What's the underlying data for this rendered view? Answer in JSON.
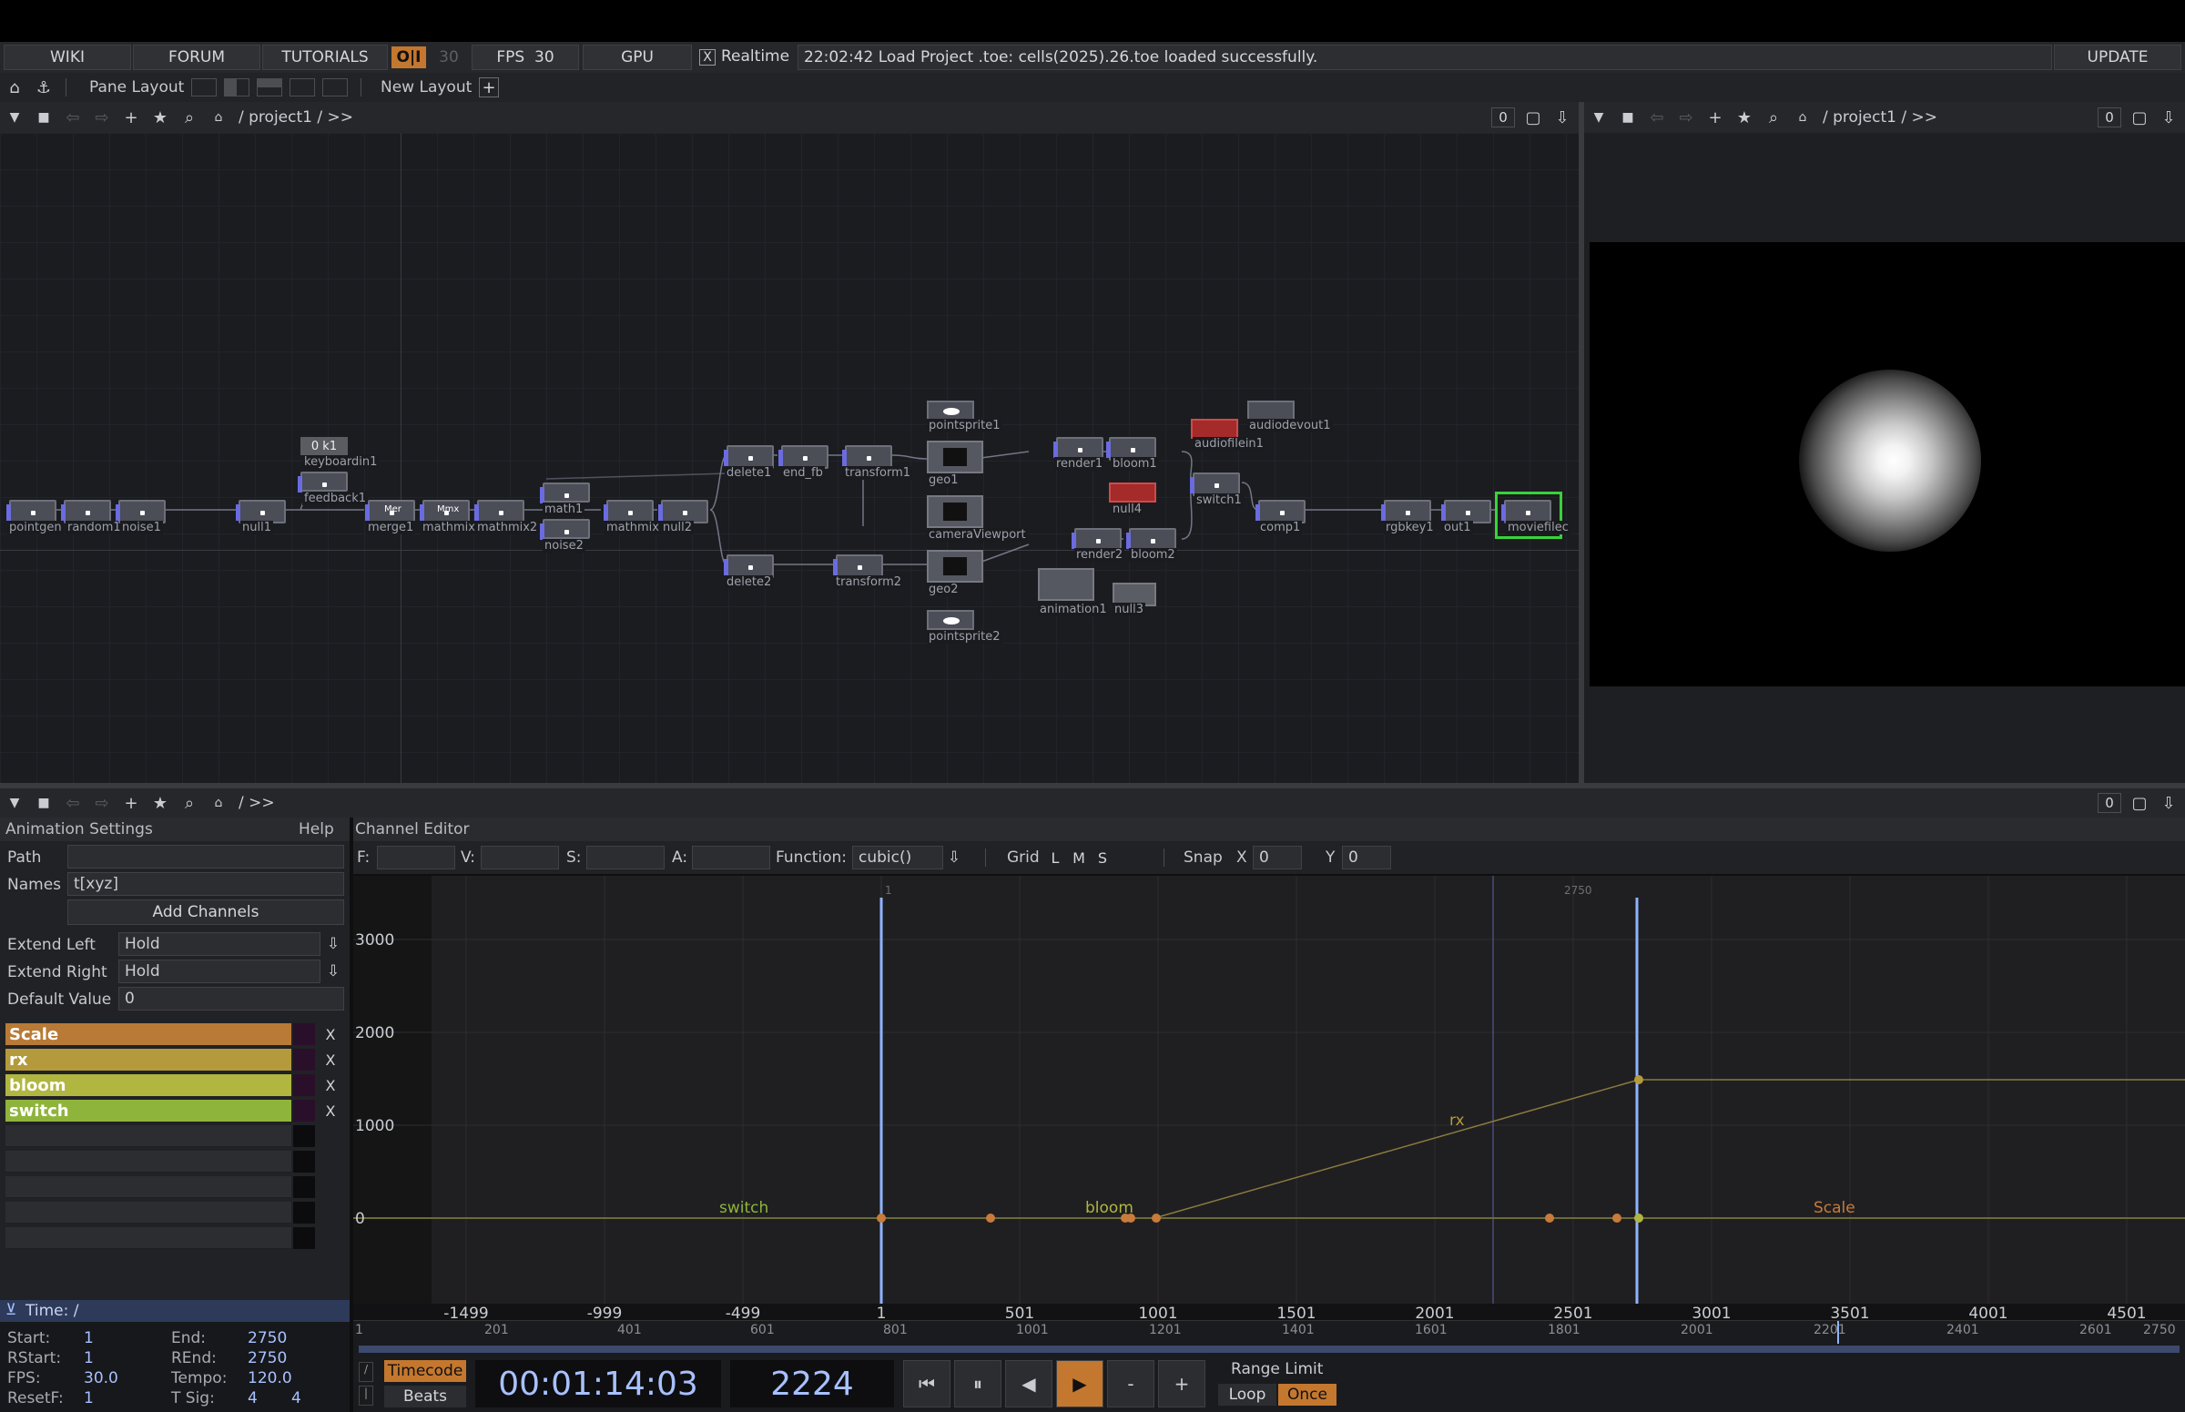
{
  "topbar": {
    "wiki": "WIKI",
    "forum": "FORUM",
    "tutorials": "TUTORIALS",
    "oi": "O|I",
    "fps_small": "30",
    "fps_label": "FPS",
    "fps_value": "30",
    "gpu": "GPU",
    "realtime_check": "X",
    "realtime": "Realtime",
    "status": "22:02:42 Load Project .toe: cells(2025).26.toe loaded successfully.",
    "update": "UPDATE"
  },
  "layoutbar": {
    "pane_layout": "Pane Layout",
    "new_layout": "New Layout",
    "plus": "+"
  },
  "network_pane": {
    "path": "/ project1 / >>",
    "counter": "0"
  },
  "viewer_pane": {
    "path": "/ project1 / >>",
    "counter": "0"
  },
  "nodes": {
    "pointgen": "pointgen",
    "random1": "random1",
    "noise1": "noise1",
    "null1": "null1",
    "keyboardin_value": "0 k1",
    "keyboardin1": "keyboardin1",
    "feedback1": "feedback1",
    "merge_icon": "Mer",
    "merge1": "merge1",
    "math_icon": "Mmx",
    "mathmix1": "mathmix1",
    "mathmix2": "mathmix2",
    "math1": "math1",
    "noise2": "noise2",
    "mathmix": "mathmix",
    "null2": "null2",
    "delete1": "delete1",
    "end_fb": "end_fb",
    "transform1": "transform1",
    "delete2": "delete2",
    "transform2": "transform2",
    "pointsprite1": "pointsprite1",
    "geo1": "geo1",
    "cameraViewport": "cameraViewport",
    "geo2": "geo2",
    "pointsprite2": "pointsprite2",
    "render1": "render1",
    "bloom1": "bloom1",
    "render2": "render2",
    "bloom2": "bloom2",
    "animation1": "animation1",
    "null3": "null3",
    "null4": "null4",
    "audiofilein1": "audiofilein1",
    "audiodevout1": "audiodevout1",
    "switch1": "switch1",
    "comp1": "comp1",
    "rgbkey1": "rgbkey1",
    "out1": "out1",
    "moviefilein": "moviefilec"
  },
  "bottom_pane": {
    "path": "/ >>",
    "counter": "0"
  },
  "anim_settings": {
    "title": "Animation Settings",
    "help": "Help",
    "path_label": "Path",
    "path_value": "",
    "names_label": "Names",
    "names_value": "t[xyz]",
    "add_channels": "Add Channels",
    "extend_left_label": "Extend Left",
    "extend_left_value": "Hold",
    "extend_right_label": "Extend Right",
    "extend_right_value": "Hold",
    "default_label": "Default Value",
    "default_value": "0",
    "dropdown_icon": "⇩",
    "channels": [
      {
        "name": "Scale",
        "color": "#b87a36",
        "x": "X"
      },
      {
        "name": "rx",
        "color": "#b49a3c",
        "x": "X"
      },
      {
        "name": "bloom",
        "color": "#b0b640",
        "x": "X"
      },
      {
        "name": "switch",
        "color": "#8fb43c",
        "x": "X"
      }
    ],
    "time_label": "Time: /"
  },
  "channel_editor": {
    "title": "Channel Editor",
    "f_label": "F:",
    "v_label": "V:",
    "s_label": "S:",
    "a_label": "A:",
    "function_label": "Function:",
    "function_value": "cubic()",
    "grid_label": "Grid",
    "grid_l": "L",
    "grid_m": "M",
    "grid_s": "S",
    "snap_label": "Snap",
    "snap_x_label": "X",
    "snap_x_value": "0",
    "snap_y_label": "Y",
    "snap_y_value": "0",
    "y_ticks": [
      "3000",
      "2000",
      "1000",
      "0"
    ],
    "x_ticks": [
      "-1499",
      "-999",
      "-499",
      "1",
      "501",
      "1001",
      "1501",
      "2001",
      "2501",
      "3001",
      "3501",
      "4001",
      "4501"
    ],
    "marker_start": "1",
    "marker_end": "2750",
    "curve_labels": {
      "switch": "switch",
      "bloom": "bloom",
      "rx": "rx",
      "scale": "Scale"
    }
  },
  "timeline": {
    "ruler": [
      "1",
      "201",
      "401",
      "601",
      "801",
      "1001",
      "1201",
      "1401",
      "1601",
      "1801",
      "2001",
      "2201",
      "2401",
      "2601",
      "2750"
    ],
    "start_label": "Start:",
    "start_value": "1",
    "end_label": "End:",
    "end_value": "2750",
    "rstart_label": "RStart:",
    "rstart_value": "1",
    "rend_label": "REnd:",
    "rend_value": "2750",
    "fps_label": "FPS:",
    "fps_value": "30.0",
    "tempo_label": "Tempo:",
    "tempo_value": "120.0",
    "resetf_label": "ResetF:",
    "resetf_value": "1",
    "tsig_label": "T Sig:",
    "tsig_a": "4",
    "tsig_b": "4",
    "timecode_btn": "Timecode",
    "beats_btn": "Beats",
    "timecode": "00:01:14:03",
    "frame": "2224",
    "minus": "-",
    "plus": "+",
    "range_limit": "Range Limit",
    "loop": "Loop",
    "once": "Once"
  },
  "colors": {
    "accent_orange": "#c4772e",
    "playhead": "#8fb3ff",
    "node_selected": "#3ad23a"
  }
}
